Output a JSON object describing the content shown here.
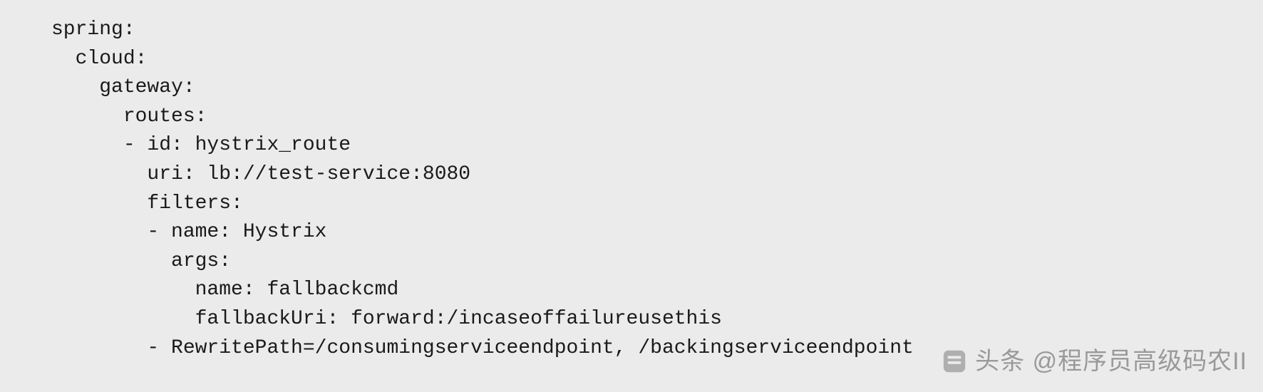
{
  "code": {
    "lines": [
      "spring:",
      "  cloud:",
      "    gateway:",
      "      routes:",
      "      - id: hystrix_route",
      "        uri: lb://test-service:8080",
      "        filters:",
      "        - name: Hystrix",
      "          args:",
      "            name: fallbackcmd",
      "            fallbackUri: forward:/incaseoffailureusethis",
      "        - RewritePath=/consumingserviceendpoint, /backingserviceendpoint"
    ]
  },
  "watermark": {
    "text": "头条 @程序员高级码农II"
  }
}
